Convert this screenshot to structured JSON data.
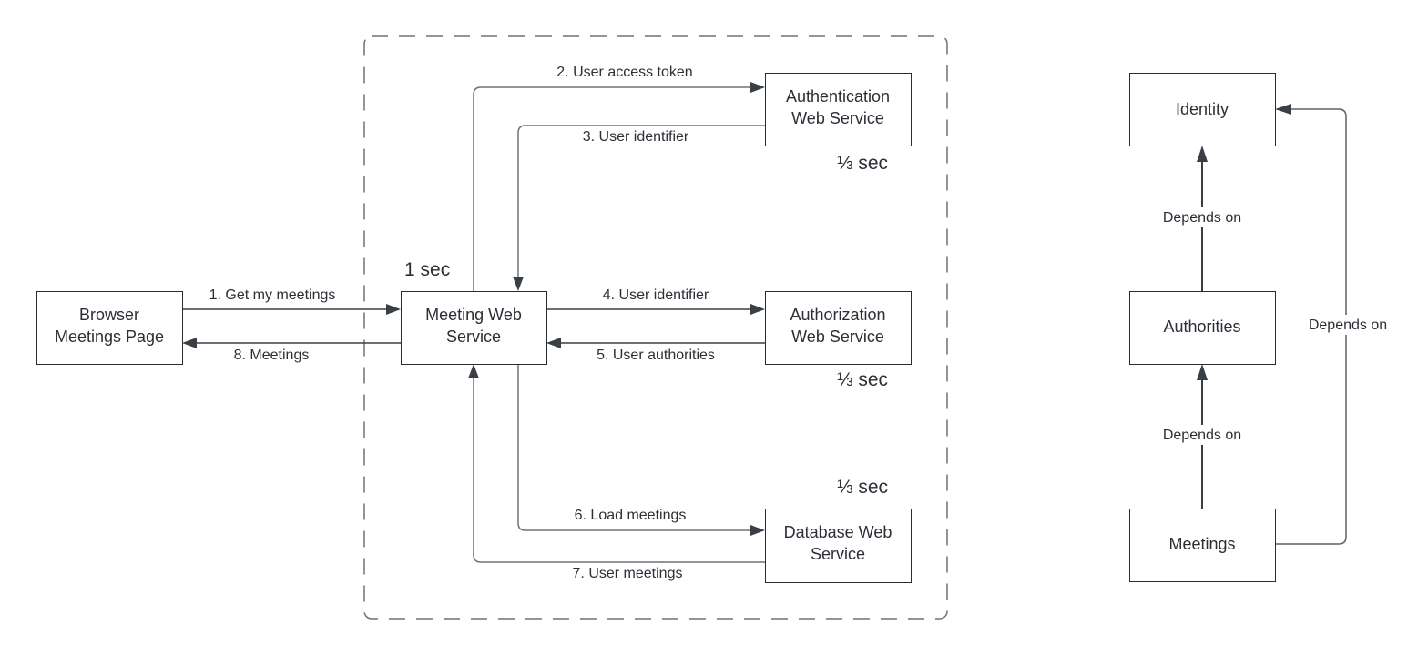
{
  "sequence_diagram": {
    "group": "service-boundary",
    "nodes": {
      "browser": [
        "Browser",
        "Meetings Page"
      ],
      "meeting": [
        "Meeting Web",
        "Service"
      ],
      "authn": [
        "Authentication",
        "Web Service"
      ],
      "authz": [
        "Authorization",
        "Web Service"
      ],
      "database": [
        "Database Web",
        "Service"
      ]
    },
    "timings": {
      "meeting": "1 sec",
      "authn": "⅓ sec",
      "authz": "⅓ sec",
      "database": "⅓ sec"
    },
    "edges": [
      {
        "from": "browser",
        "to": "meeting",
        "label": "1. Get my meetings"
      },
      {
        "from": "meeting",
        "to": "authn",
        "label": "2. User access token"
      },
      {
        "from": "authn",
        "to": "meeting",
        "label": "3. User identifier"
      },
      {
        "from": "meeting",
        "to": "authz",
        "label": "4. User identifier"
      },
      {
        "from": "authz",
        "to": "meeting",
        "label": "5. User authorities"
      },
      {
        "from": "meeting",
        "to": "database",
        "label": "6. Load meetings"
      },
      {
        "from": "database",
        "to": "meeting",
        "label": "7. User meetings"
      },
      {
        "from": "meeting",
        "to": "browser",
        "label": "8. Meetings"
      }
    ]
  },
  "dependency_diagram": {
    "nodes": {
      "identity": "Identity",
      "authorities": "Authorities",
      "meetings": "Meetings"
    },
    "edges": [
      {
        "from": "authorities",
        "to": "identity",
        "label": "Depends on"
      },
      {
        "from": "meetings",
        "to": "authorities",
        "label": "Depends on"
      },
      {
        "from": "meetings",
        "to": "identity",
        "label": "Depends on"
      }
    ]
  }
}
